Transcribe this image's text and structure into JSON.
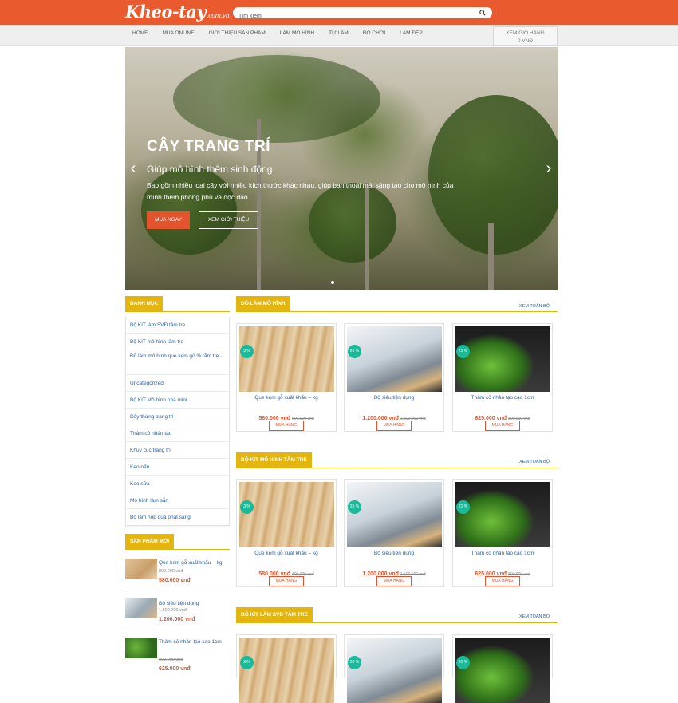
{
  "header": {
    "logo_text": "Kheo-tay",
    "logo_domain": ".com.vn",
    "search_placeholder": "Tìm kiếm",
    "accent_color": "#ea5a2f"
  },
  "nav": {
    "items": [
      "HOME",
      "MUA ONLINE",
      "GIỚI THIỆU SẢN PHẨM",
      "LÀM MÔ HÌNH",
      "TỰ LÀM",
      "ĐỒ CHƠI",
      "LÀM ĐẸP"
    ],
    "cart_label": "XEM GIỎ HÀNG",
    "cart_total": "0 VNĐ"
  },
  "slider": {
    "title": "CÂY TRANG TRÍ",
    "subtitle": "Giúp mô hình thêm sinh động",
    "description": "Bao gồm nhiều loại cây với nhiều kích thước khác nhau, giúp bạn thoải mái sáng tạo cho mô hình của mình thêm phong phú và độc đáo",
    "buy_label": "MUA NGAY",
    "view_label": "XEM GIỚI THIỆU"
  },
  "sidebar": {
    "categories_title": "DANH MỤC",
    "categories": [
      "Bộ KIT làm SVĐ tăm tre",
      "Bộ KIT mô hình tăm tre",
      "Đồ làm mô hình que kem gỗ % tăm tre ⌄",
      "Uncategorized",
      "Bộ KIT Mô hình nhà mini",
      "Dây thừng trang trí",
      "Thảm cỏ nhân tạo",
      "Khuy cúc trang trí",
      "Keo nến",
      "Keo sữa",
      "Mô hình làm sẵn",
      "Bộ làm hộp quà phát sáng"
    ],
    "new_products_title": "SẢN PHẨM MỚI",
    "new_products": [
      {
        "name": "Que kem gỗ xuất khẩu – kg",
        "old_price": "800.000 vnđ",
        "price": "580.000 vnđ"
      },
      {
        "name": "Bộ siêu tiện dụng",
        "old_price": "1.500.000 vnđ",
        "price": "1.200.000 vnđ"
      },
      {
        "name": "Thảm cỏ nhân tạo cao 1cm",
        "old_price": "800.000 vnđ",
        "price": "625.000 vnđ"
      }
    ]
  },
  "sections": [
    {
      "title": "ĐỒ LÀM MÔ HÌNH",
      "view_all": "XEM TOÀN BỘ"
    },
    {
      "title": "BỘ KIT MÔ HÌNH TĂM TRE",
      "view_all": "XEM TOÀN BỘ"
    },
    {
      "title": "BỘ KIT LÀM SVĐ TĂM TRE",
      "view_all": "XEM TOÀN BỘ"
    }
  ],
  "products": [
    {
      "badge": "3 %",
      "name": "Que kem gỗ xuất khẩu – kg",
      "price": "580.000 vnđ",
      "old_price": "600.000 vnđ",
      "buy_label": "MUA HÀNG"
    },
    {
      "badge": "20 %",
      "name": "Bộ siêu tiện dụng",
      "price": "1.200.000 vnđ",
      "old_price": "1.500.000 vnđ",
      "buy_label": "MUA HÀNG"
    },
    {
      "badge": "21 %",
      "name": "Thảm cỏ nhân tạo cao 1cm",
      "price": "625.000 vnđ",
      "old_price": "800.000 vnđ",
      "buy_label": "MUA HÀNG"
    }
  ]
}
